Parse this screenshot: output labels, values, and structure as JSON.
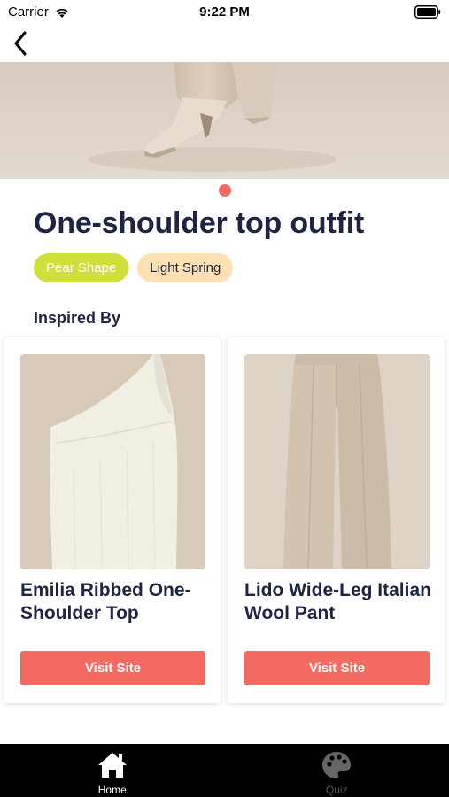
{
  "status_bar": {
    "carrier": "Carrier",
    "time": "9:22 PM"
  },
  "nav": {
    "back_icon": "chevron-left-icon"
  },
  "hero": {
    "image_description_icon": "shoe-photo"
  },
  "pager": {
    "active_page": 1,
    "total_pages": 1
  },
  "outfit": {
    "title": "One-shoulder top outfit",
    "tags": [
      {
        "label": "Pear Shape",
        "color": "#cfe03a"
      },
      {
        "label": "Light Spring",
        "color": "#fde0b3"
      }
    ]
  },
  "inspired": {
    "heading": "Inspired By",
    "items": [
      {
        "title": "Emilia Ribbed One-Shoulder Top",
        "button_label": "Visit Site",
        "image_icon": "one-shoulder-top-photo"
      },
      {
        "title": "Lido Wide-Leg Italian Wool Pant",
        "button_label": "Visit Site",
        "image_icon": "wide-leg-pant-photo"
      }
    ]
  },
  "tab_bar": {
    "tabs": [
      {
        "label": "Home",
        "icon": "home-icon",
        "active": true
      },
      {
        "label": "Quiz",
        "icon": "palette-icon",
        "active": false
      }
    ]
  },
  "colors": {
    "accent": "#f26a61",
    "text": "#1e2544"
  }
}
